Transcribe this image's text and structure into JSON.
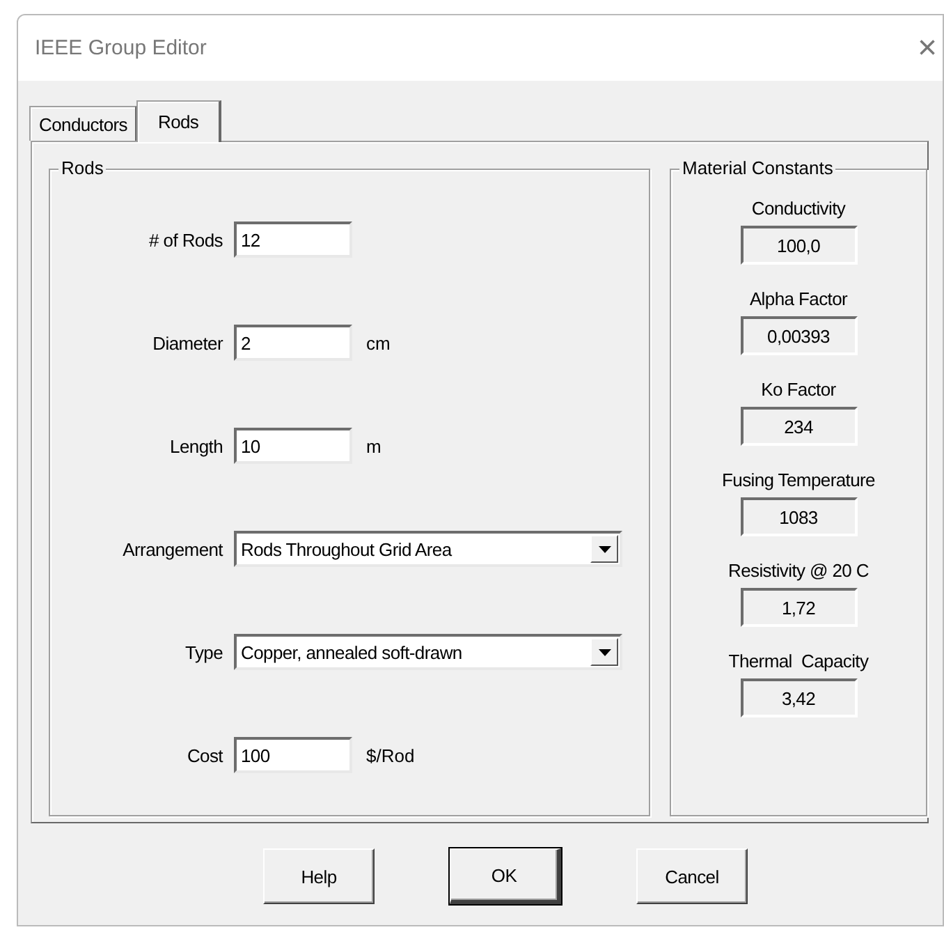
{
  "window": {
    "title": "IEEE Group Editor",
    "close": "×"
  },
  "tabs": [
    {
      "label": "Conductors",
      "selected": false
    },
    {
      "label": "Rods",
      "selected": true
    }
  ],
  "rods": {
    "title": "Rods",
    "fields": [
      {
        "kind": "text",
        "label": "# of Rods",
        "value": "12"
      },
      {
        "kind": "text",
        "label": "Diameter",
        "value": "2",
        "unit": "cm"
      },
      {
        "kind": "text",
        "label": "Length",
        "value": "10",
        "unit": "m"
      },
      {
        "kind": "combo",
        "label": "Arrangement",
        "value": "Rods Throughout Grid Area"
      },
      {
        "kind": "combo",
        "label": "Type",
        "value": "Copper, annealed soft-drawn"
      },
      {
        "kind": "text",
        "label": "Cost",
        "value": "100",
        "unit": "$/Rod"
      }
    ]
  },
  "material_constants": {
    "title": "Material Constants",
    "items": [
      {
        "label": "Conductivity",
        "value": "100,0"
      },
      {
        "label": "Alpha Factor",
        "value": "0,00393"
      },
      {
        "label": "Ko Factor",
        "value": "234"
      },
      {
        "label": "Fusing Temperature",
        "value": "1083"
      },
      {
        "label": "Resistivity @ 20 C",
        "value": "1,72"
      },
      {
        "label": "Thermal  Capacity",
        "value": "3,42"
      }
    ]
  },
  "buttons": [
    {
      "label": "Help",
      "default": false
    },
    {
      "label": "OK",
      "default": true
    },
    {
      "label": "Cancel",
      "default": false
    }
  ]
}
